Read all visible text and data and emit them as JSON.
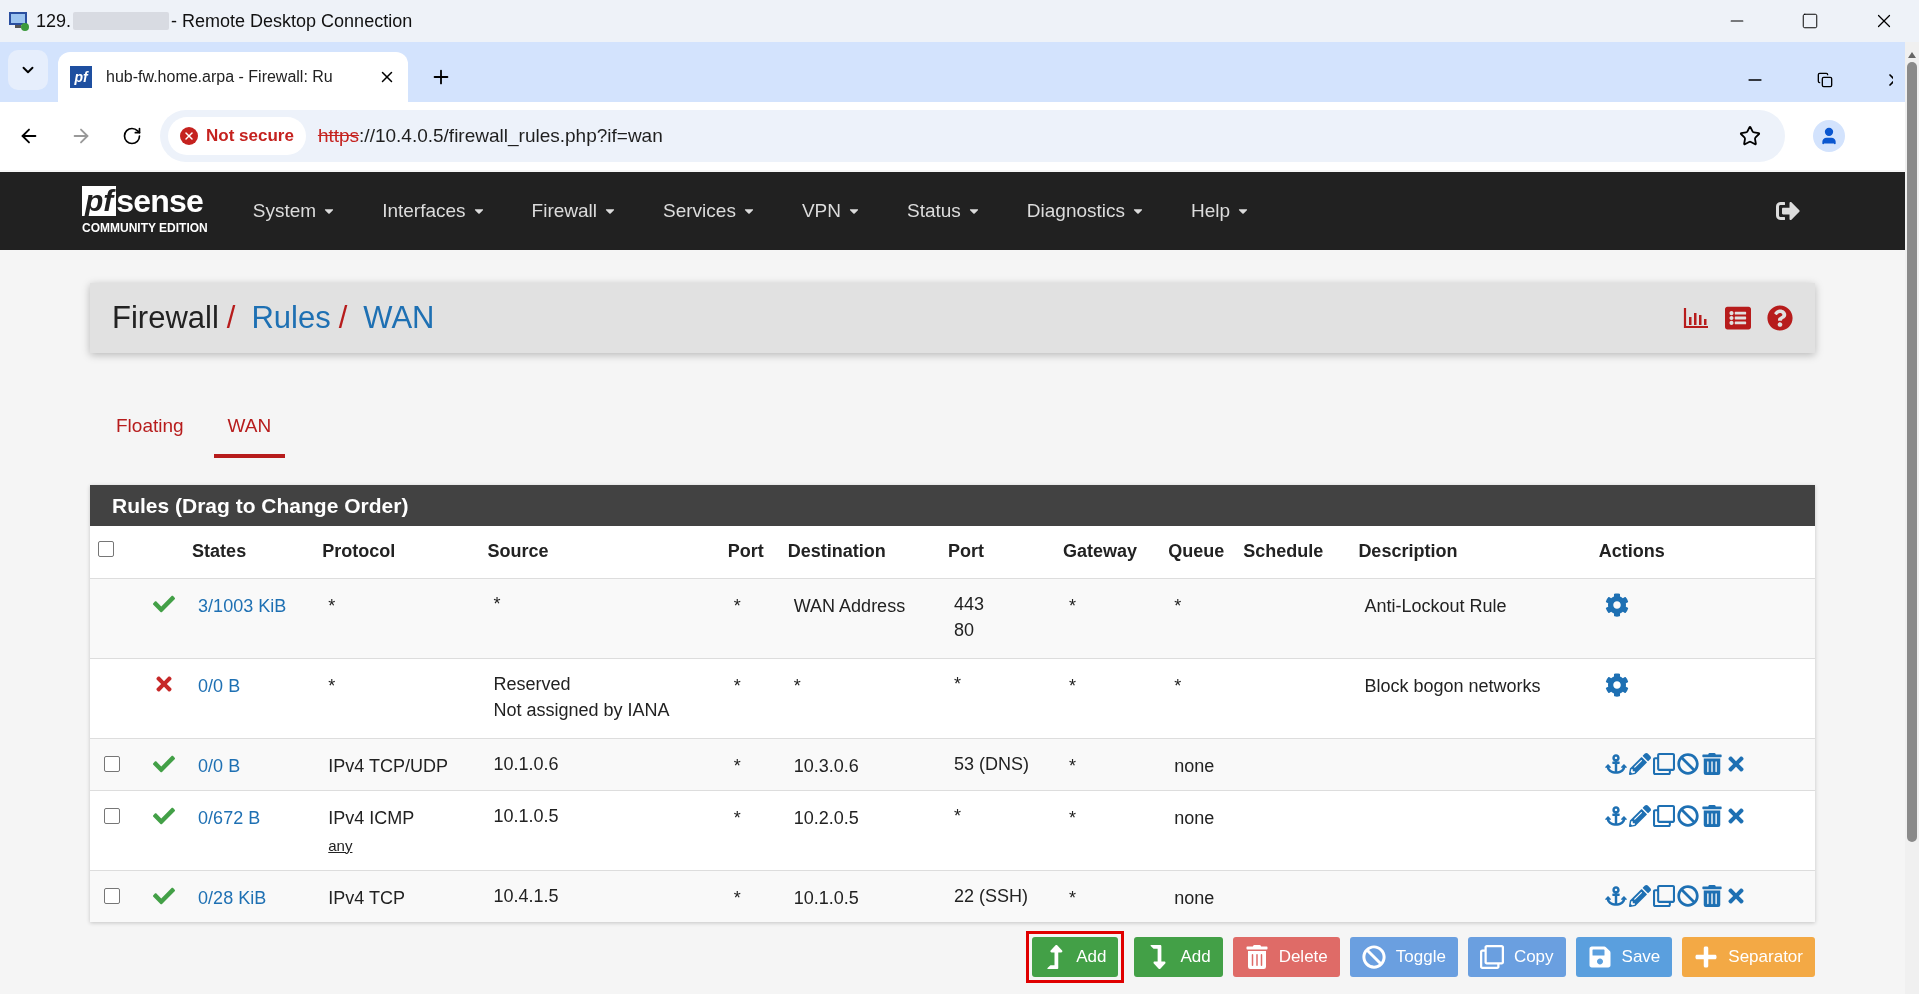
{
  "window": {
    "title_start": "129.",
    "title_end": "- Remote Desktop Connection"
  },
  "browser": {
    "tab_title": "hub-fw.home.arpa - Firewall: Ru",
    "tab_favicon": "pf",
    "security": "Not secure",
    "url_scheme": "https",
    "url_rest": "://10.4.0.5/firewall_rules.php?if=wan"
  },
  "logo": {
    "mark": "pf",
    "word": "sense",
    "edition": "COMMUNITY EDITION"
  },
  "menu": [
    "System",
    "Interfaces",
    "Firewall",
    "Services",
    "VPN",
    "Status",
    "Diagnostics",
    "Help"
  ],
  "breadcrumb": {
    "items": [
      "Firewall",
      "Rules",
      "WAN"
    ],
    "separator": "/"
  },
  "tabs": [
    {
      "label": "Floating",
      "selected": false
    },
    {
      "label": "WAN",
      "selected": true
    }
  ],
  "panel_title": "Rules (Drag to Change Order)",
  "select_all": {
    "checked": false
  },
  "columns": [
    "States",
    "Protocol",
    "Source",
    "Port",
    "Destination",
    "Port",
    "Gateway",
    "Queue",
    "Schedule",
    "Description",
    "Actions"
  ],
  "rows": [
    {
      "kind": "system",
      "blocked": false,
      "states": "3/1003 KiB",
      "protocol": "*",
      "source": [
        "*"
      ],
      "port": "*",
      "destination": "WAN Address",
      "dest_port": [
        "443",
        "80"
      ],
      "gateway": "*",
      "queue": "*",
      "description": "Anti-Lockout Rule"
    },
    {
      "kind": "system",
      "blocked": true,
      "states": "0/0 B",
      "protocol": "*",
      "source": [
        "Reserved",
        "Not assigned by IANA"
      ],
      "port": "*",
      "destination": "*",
      "dest_port": [
        "*"
      ],
      "gateway": "*",
      "queue": "*",
      "description": "Block bogon networks"
    },
    {
      "kind": "user",
      "checked": false,
      "blocked": false,
      "states": "0/0 B",
      "protocol": "IPv4 TCP/UDP",
      "source": [
        "10.1.0.6"
      ],
      "port": "*",
      "destination": "10.3.0.6",
      "dest_port": [
        "53 (DNS)"
      ],
      "gateway": "*",
      "queue": "none"
    },
    {
      "kind": "user",
      "checked": false,
      "blocked": false,
      "states": "0/672 B",
      "protocol": "IPv4 ICMP",
      "protocol_note": "any",
      "source": [
        "10.1.0.5"
      ],
      "port": "*",
      "destination": "10.2.0.5",
      "dest_port": [
        "*"
      ],
      "gateway": "*",
      "queue": "none"
    },
    {
      "kind": "user",
      "checked": false,
      "blocked": false,
      "states": "0/28 KiB",
      "protocol": "IPv4 TCP",
      "source": [
        "10.4.1.5"
      ],
      "port": "*",
      "destination": "10.1.0.5",
      "dest_port": [
        "22 (SSH)"
      ],
      "gateway": "*",
      "queue": "none"
    }
  ],
  "buttons": [
    {
      "kind": "add_top",
      "label": "Add",
      "highlighted": true
    },
    {
      "kind": "add_bottom",
      "label": "Add",
      "highlighted": false
    },
    {
      "kind": "delete",
      "label": "Delete",
      "highlighted": false
    },
    {
      "kind": "toggle",
      "label": "Toggle",
      "highlighted": false
    },
    {
      "kind": "copy",
      "label": "Copy",
      "highlighted": false
    },
    {
      "kind": "save",
      "label": "Save",
      "highlighted": false
    },
    {
      "kind": "separator",
      "label": "Separator",
      "highlighted": false
    }
  ]
}
